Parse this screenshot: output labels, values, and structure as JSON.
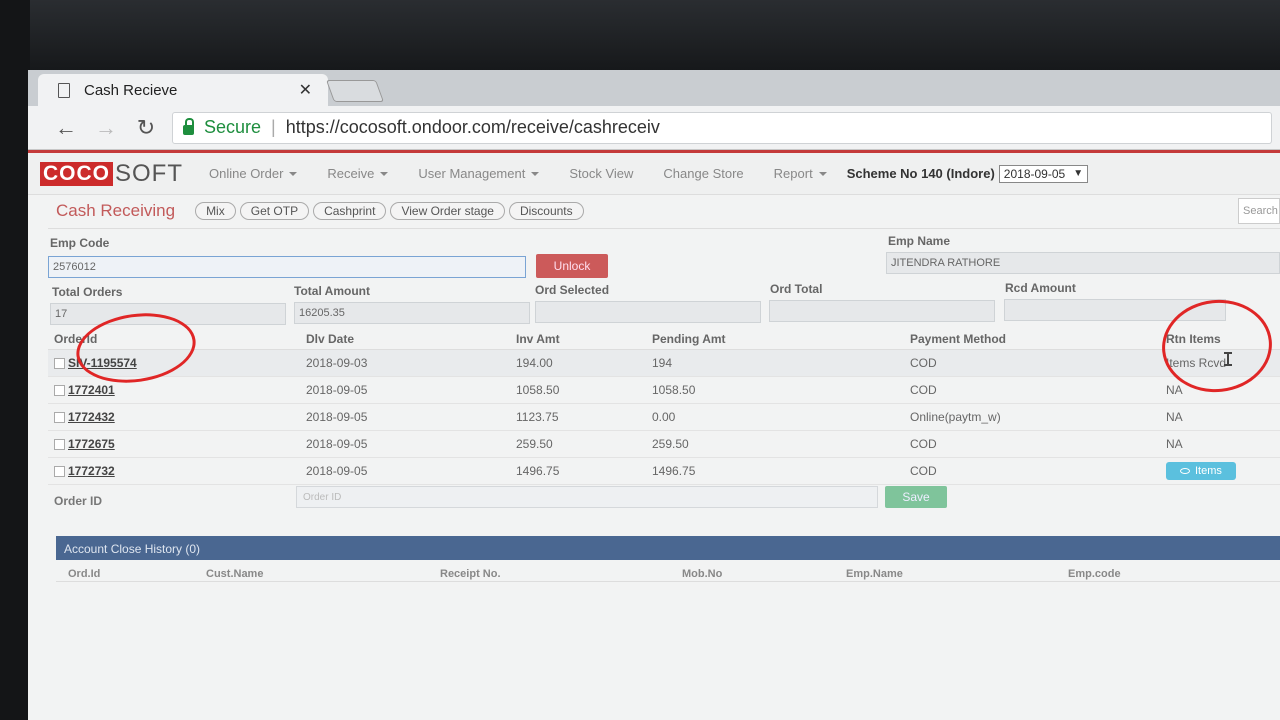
{
  "browser": {
    "tab_title": "Cash Recieve",
    "secure_label": "Secure",
    "url": "https://cocosoft.ondoor.com/receive/cashreceiv"
  },
  "app": {
    "logo_left": "COCO",
    "logo_right": "SOFT",
    "nav": [
      "Online Order",
      "Receive",
      "User Management",
      "Stock View",
      "Change Store",
      "Report"
    ],
    "scheme": "Scheme No 140 (Indore)",
    "date": "2018-09-05"
  },
  "toolbar": {
    "title": "Cash Receiving",
    "buttons": [
      "Mix",
      "Get OTP",
      "Cashprint",
      "View Order stage",
      "Discounts"
    ],
    "search_placeholder": "Search"
  },
  "form": {
    "emp_code_label": "Emp Code",
    "emp_code": "2576012",
    "unlock_label": "Unlock",
    "emp_name_label": "Emp Name",
    "emp_name": "JITENDRA RATHORE",
    "total_orders_label": "Total Orders",
    "total_orders": "17",
    "total_amount_label": "Total Amount",
    "total_amount": "16205.35",
    "ord_selected_label": "Ord Selected",
    "ord_total_label": "Ord Total",
    "rcd_amount_label": "Rcd Amount"
  },
  "table": {
    "headers": [
      "OrderId",
      "Dlv Date",
      "Inv Amt",
      "Pending Amt",
      "Payment Method",
      "Rtn Items"
    ],
    "rows": [
      {
        "id": "SIV-1195574",
        "date": "2018-09-03",
        "inv": "194.00",
        "pending": "194",
        "method": "COD",
        "rtn": "Items Rcvd"
      },
      {
        "id": "1772401",
        "date": "2018-09-05",
        "inv": "1058.50",
        "pending": "1058.50",
        "method": "COD",
        "rtn": "NA"
      },
      {
        "id": "1772432",
        "date": "2018-09-05",
        "inv": "1123.75",
        "pending": "0.00",
        "method": "Online(paytm_w)",
        "rtn": "NA"
      },
      {
        "id": "1772675",
        "date": "2018-09-05",
        "inv": "259.50",
        "pending": "259.50",
        "method": "COD",
        "rtn": "NA"
      },
      {
        "id": "1772732",
        "date": "2018-09-05",
        "inv": "1496.75",
        "pending": "1496.75",
        "method": "COD",
        "rtn": "Items"
      }
    ]
  },
  "order_entry": {
    "label": "Order ID",
    "placeholder": "Order ID",
    "save_label": "Save"
  },
  "history": {
    "title": "Account Close History (0)",
    "headers": [
      "Ord.Id",
      "Cust.Name",
      "Receipt No.",
      "Mob.No",
      "Emp.Name",
      "Emp.code"
    ]
  }
}
